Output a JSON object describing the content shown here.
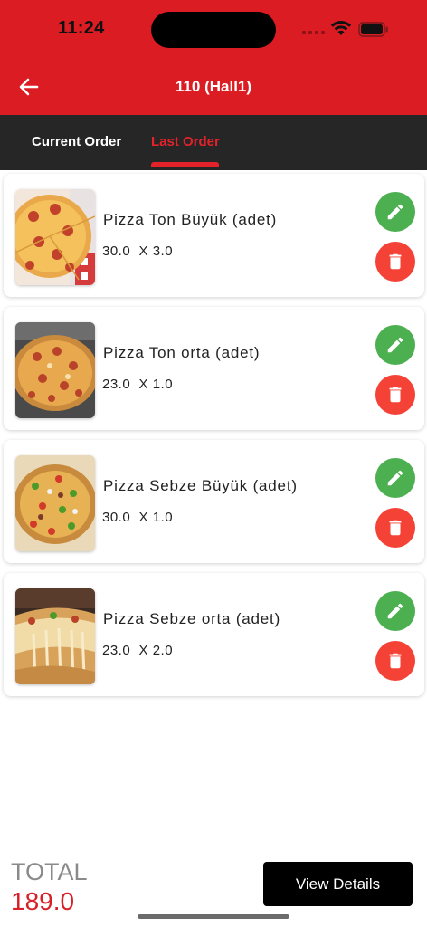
{
  "status_bar": {
    "time": "11:24"
  },
  "header": {
    "title": "110 (Hall1)",
    "back_icon": "arrow-left-icon"
  },
  "tabs": [
    {
      "label": "Current Order",
      "active": false
    },
    {
      "label": "Last Order",
      "active": true
    }
  ],
  "colors": {
    "primary": "#dc1c23",
    "tabbar": "#262626",
    "edit": "#4caf50",
    "delete": "#f44336",
    "active_tab": "#e3222a"
  },
  "items": [
    {
      "name": "Pizza Ton Büyük (adet)",
      "price": "30.0",
      "quantity": "3.0",
      "qty_text": "30.0  X 3.0"
    },
    {
      "name": "Pizza Ton orta (adet)",
      "price": "23.0",
      "quantity": "1.0",
      "qty_text": "23.0  X 1.0"
    },
    {
      "name": "Pizza Sebze Büyük (adet)",
      "price": "30.0",
      "quantity": "1.0",
      "qty_text": "30.0  X 1.0"
    },
    {
      "name": "Pizza Sebze orta (adet)",
      "price": "23.0",
      "quantity": "2.0",
      "qty_text": "23.0  X 2.0"
    }
  ],
  "footer": {
    "total_label": "TOTAL",
    "total_value": "189.0",
    "view_details_label": "View Details"
  }
}
